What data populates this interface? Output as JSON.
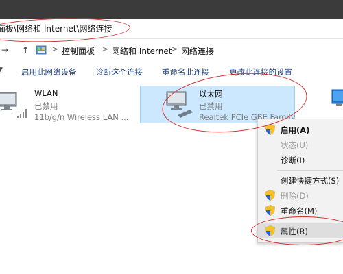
{
  "window": {
    "title_path": "面板\\网络和 Internet\\网络连接"
  },
  "address": {
    "crumbs": [
      "控制面板",
      "网络和 Internet",
      "网络连接"
    ],
    "separator": ">",
    "forward_glyph": "→",
    "up_glyph": "↑"
  },
  "commands": [
    "启用此网络设备",
    "诊断这个连接",
    "重命名此连接",
    "更改此连接的设置"
  ],
  "adapters": {
    "wlan": {
      "name": "WLAN",
      "status": "已禁用",
      "device": "11b/g/n  Wireless LAN ..."
    },
    "ethernet": {
      "name": "以太网",
      "status": "已禁用",
      "device": "Realtek PCIe GBE Family..."
    }
  },
  "context_menu": {
    "items": [
      {
        "label": "启用(A)",
        "enabled": true,
        "bold": true,
        "shield": true
      },
      {
        "label": "状态(U)",
        "enabled": false,
        "bold": false,
        "shield": false
      },
      {
        "label": "诊断(I)",
        "enabled": true,
        "bold": false,
        "shield": false
      },
      {
        "label": "创建快捷方式(S)",
        "enabled": true,
        "bold": false,
        "shield": false
      },
      {
        "label": "删除(D)",
        "enabled": false,
        "bold": false,
        "shield": true
      },
      {
        "label": "重命名(M)",
        "enabled": true,
        "bold": false,
        "shield": true
      },
      {
        "label": "属性(R)",
        "enabled": true,
        "bold": false,
        "shield": true,
        "highlighted": true
      }
    ]
  },
  "colors": {
    "selection_bg": "#cce8ff",
    "annotation": "#d0302f",
    "titlebar": "#3b3b3b"
  },
  "icons": [
    "control-panel-icon",
    "network-adapter-icon",
    "wifi-signal-icon",
    "uac-shield-icon"
  ]
}
